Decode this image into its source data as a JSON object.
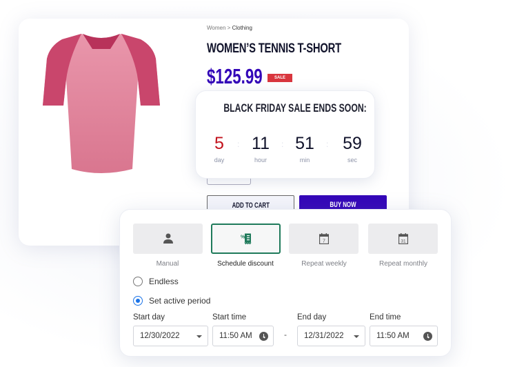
{
  "product": {
    "breadcrumb": {
      "parent": "Women",
      "separator": ">",
      "current": "Clothing"
    },
    "title": "WOMEN’S TENNIS T-SHORT",
    "price": "$125.99",
    "badge": "SALE",
    "image_alt": "pink women's t-shirt",
    "add_to_cart_label": "ADD TO CART",
    "buy_now_label": "BUY NOW",
    "colors": {
      "price": "#3306b8",
      "badge": "#d9363e",
      "buy_now": "#3306b8"
    }
  },
  "countdown": {
    "title": "BLACK FRIDAY SALE ENDS SOON:",
    "separator": ":",
    "units": [
      {
        "value": "5",
        "label": "day"
      },
      {
        "value": "11",
        "label": "hour"
      },
      {
        "value": "51",
        "label": "min"
      },
      {
        "value": "59",
        "label": "sec"
      }
    ]
  },
  "schedule": {
    "options": [
      {
        "label": "Manual",
        "icon": "person-icon",
        "selected": false
      },
      {
        "label": "Schedule discount",
        "icon": "discount-receipt-icon",
        "selected": true
      },
      {
        "label": "Repeat weekly",
        "icon": "calendar-7-icon",
        "selected": false
      },
      {
        "label": "Repeat monthly",
        "icon": "calendar-31-icon",
        "selected": false
      }
    ],
    "calendar_weekly_num": "7",
    "calendar_monthly_num": "31",
    "radios": [
      {
        "label": "Endless",
        "checked": false
      },
      {
        "label": "Set active period",
        "checked": true
      }
    ],
    "fields": {
      "start_day": {
        "label": "Start day",
        "value": "12/30/2022"
      },
      "start_time": {
        "label": "Start time",
        "value": "11:50 AM"
      },
      "range_separator": "-",
      "end_day": {
        "label": "End day",
        "value": "12/31/2022"
      },
      "end_time": {
        "label": "End time",
        "value": "11:50 AM"
      }
    },
    "accent_color": "#1e7a5a",
    "radio_color": "#1a73e8"
  }
}
